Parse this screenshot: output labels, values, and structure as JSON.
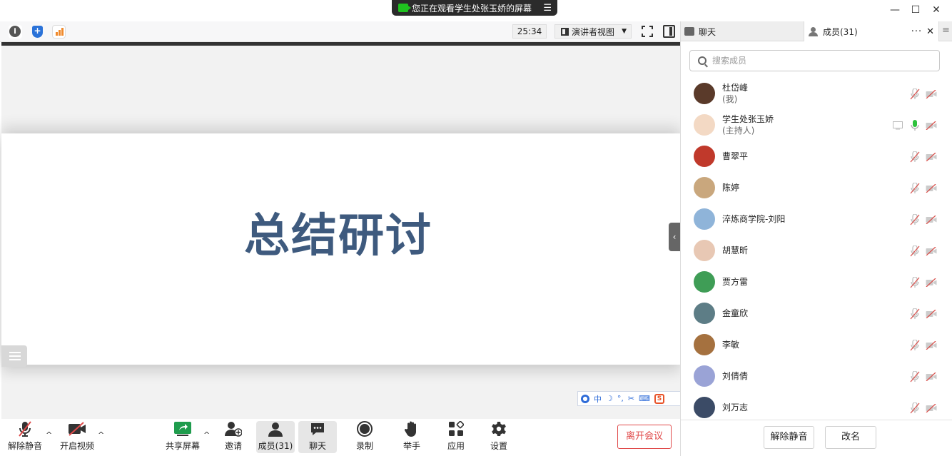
{
  "banner": {
    "text": "您正在观看学生处张玉娇的屏幕",
    "menu_icon": "menu-lines-icon"
  },
  "window": {
    "minimize": "—",
    "maximize": "☐",
    "close": "✕"
  },
  "toolbar": {
    "timer": "25:34",
    "view_label": "演讲者视图"
  },
  "slide": {
    "title": "总结研讨"
  },
  "ime": {
    "items": [
      "中",
      "☽",
      "°,",
      "✂",
      "⌨"
    ],
    "sougou": "S"
  },
  "bottom": {
    "unmute": "解除静音",
    "start_video": "开启视频",
    "share_screen": "共享屏幕",
    "invite": "邀请",
    "members": "成员(31)",
    "chat": "聊天",
    "record": "录制",
    "raise_hand": "举手",
    "apps": "应用",
    "settings": "设置",
    "leave": "离开会议"
  },
  "panel": {
    "chat_tab": "聊天",
    "members_tab": "成员(31)",
    "more": "···",
    "close": "✕",
    "search_placeholder": "搜索成员",
    "unmute_btn": "解除静音",
    "rename_btn": "改名"
  },
  "members": [
    {
      "name": "杜岱峰",
      "role": "(我)",
      "avatar": "#5a3a2a",
      "mic": "off",
      "screen": false
    },
    {
      "name": "学生处张玉娇",
      "role": "(主持人)",
      "avatar": "#f3d9c4",
      "mic": "on",
      "screen": true
    },
    {
      "name": "曹翠平",
      "role": "",
      "avatar": "#c0392b",
      "mic": "off",
      "screen": false
    },
    {
      "name": "陈婷",
      "role": "",
      "avatar": "#c9a77d",
      "mic": "off",
      "screen": false
    },
    {
      "name": "淬炼商学院-刘阳",
      "role": "",
      "avatar": "#8fb4d9",
      "mic": "off",
      "screen": false
    },
    {
      "name": "胡慧昕",
      "role": "",
      "avatar": "#e8c8b4",
      "mic": "off",
      "screen": false
    },
    {
      "name": "贾方雷",
      "role": "",
      "avatar": "#3f9d56",
      "mic": "off",
      "screen": false
    },
    {
      "name": "金童欣",
      "role": "",
      "avatar": "#5d7d86",
      "mic": "off",
      "screen": false
    },
    {
      "name": "李敏",
      "role": "",
      "avatar": "#a5713f",
      "mic": "off",
      "screen": false
    },
    {
      "name": "刘倩倩",
      "role": "",
      "avatar": "#9aa3d6",
      "mic": "off",
      "screen": false
    },
    {
      "name": "刘万志",
      "role": "",
      "avatar": "#3b4b66",
      "mic": "off",
      "screen": false
    }
  ],
  "colors": {
    "slide_title": "#3e5a7e",
    "leave": "#e04a4a",
    "mic_on": "#2ec23d",
    "muted": "#d9534f"
  }
}
